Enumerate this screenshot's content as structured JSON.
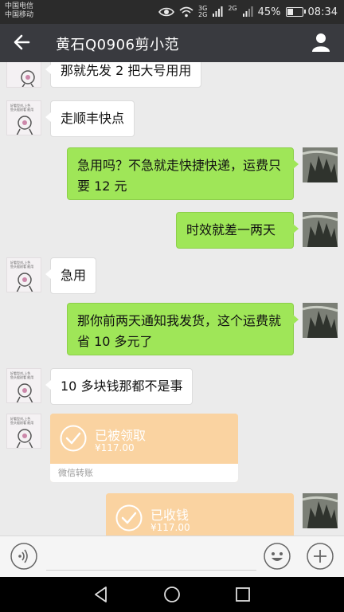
{
  "status_bar": {
    "carrier_1": "中国电信",
    "carrier_2": "中国移动",
    "net_1": "3G",
    "net_2": "2G",
    "battery": "45%",
    "battery_level": 0.45,
    "time": "08:34"
  },
  "header": {
    "title": "黄石Q0906剪小范",
    "back_icon": "arrow-left-icon",
    "profile_icon": "person-icon"
  },
  "messages": [
    {
      "side": "in",
      "text": "那就先发 2 把大号用用"
    },
    {
      "side": "in",
      "text": "走顺丰快点"
    },
    {
      "side": "out",
      "text": "急用吗？不急就走快捷快递，运费只要 12 元"
    },
    {
      "side": "out",
      "text": "时效就差一两天"
    },
    {
      "side": "in",
      "text": "急用"
    },
    {
      "side": "out",
      "text": "那你前两天通知我发货，这个运费就省 10 多元了"
    },
    {
      "side": "in",
      "text": "10 多块钱那都不是事"
    }
  ],
  "transfers": [
    {
      "side": "in",
      "status": "已被领取",
      "amount": "¥117.00",
      "footer": "微信转账"
    },
    {
      "side": "out",
      "status": "已收钱",
      "amount": "¥117.00"
    }
  ],
  "avatar_text": {
    "line1": "好看型刘,上色",
    "line2": "鱼头般耐看 能用"
  },
  "input_bar": {
    "voice_icon": "voice-icon",
    "emoji_icon": "emoji-icon",
    "plus_icon": "plus-icon"
  },
  "nav_bar": {
    "back_icon": "nav-back-icon",
    "home_icon": "nav-home-icon",
    "recent_icon": "nav-recent-icon"
  },
  "colors": {
    "title_bg": "#393a3f",
    "bubble_out": "#9fe658",
    "bubble_in": "#ffffff",
    "transfer": "#fad3a1",
    "chat_bg": "#ebebeb"
  }
}
